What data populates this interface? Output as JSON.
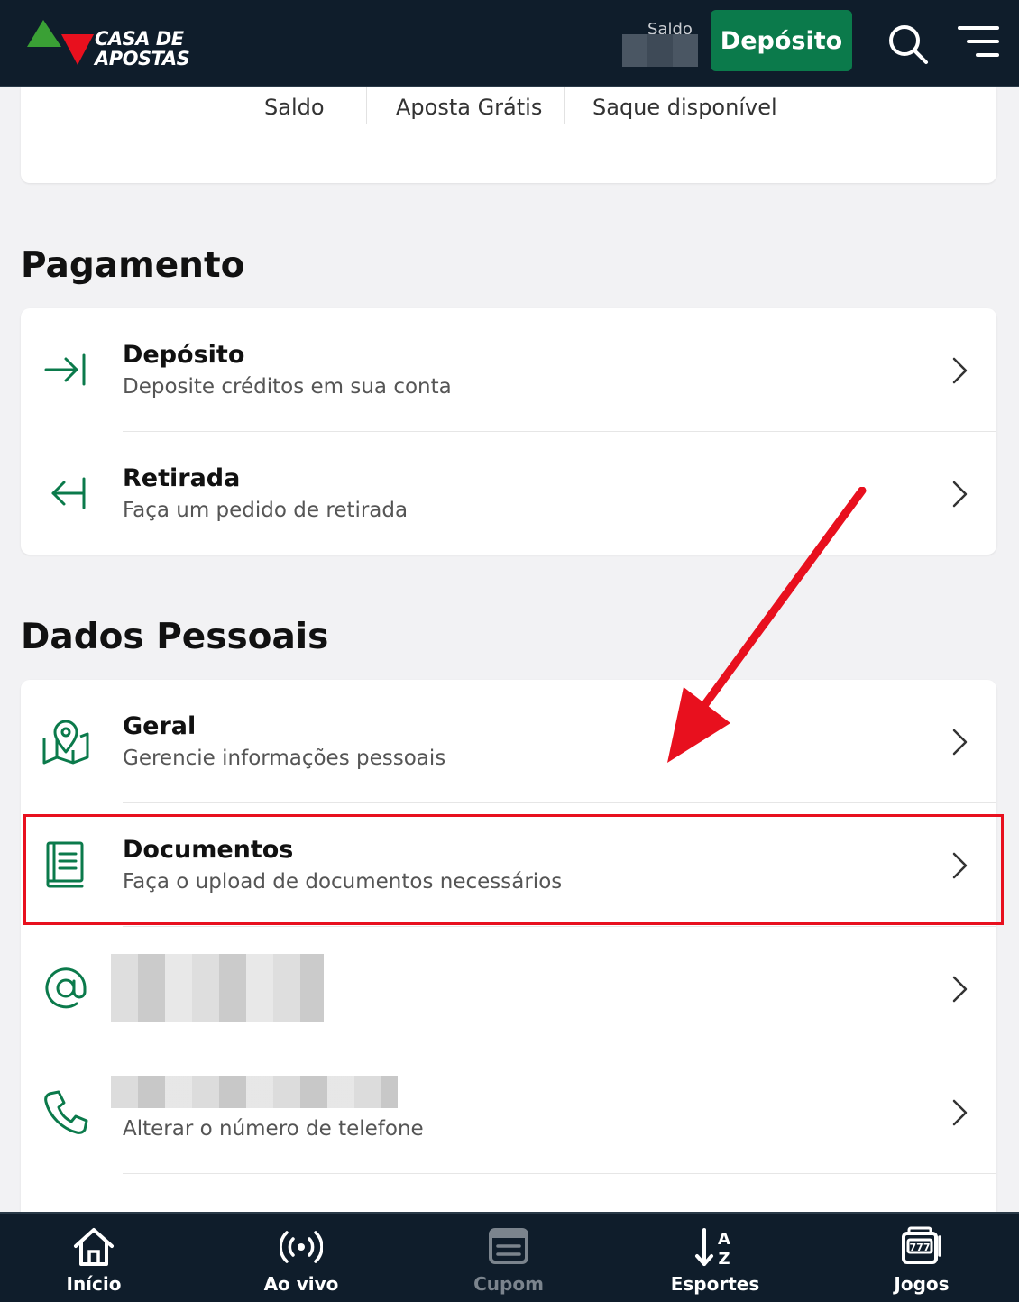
{
  "header": {
    "logo_line1": "CASA DE",
    "logo_line2": "APOSTAS",
    "saldo_label": "Saldo",
    "deposit_button": "Depósito"
  },
  "summary": {
    "items": [
      "Saldo",
      "Aposta Grátis",
      "Saque disponível"
    ]
  },
  "payment": {
    "title": "Pagamento",
    "items": [
      {
        "title": "Depósito",
        "subtitle": "Deposite créditos em sua conta"
      },
      {
        "title": "Retirada",
        "subtitle": "Faça um pedido de retirada"
      }
    ]
  },
  "personal": {
    "title": "Dados Pessoais",
    "items": [
      {
        "title": "Geral",
        "subtitle": "Gerencie informações pessoais"
      },
      {
        "title": "Documentos",
        "subtitle": "Faça o upload de documentos necessários"
      },
      {
        "title": "",
        "subtitle": ""
      },
      {
        "title": "",
        "subtitle": "Alterar o número de telefone"
      }
    ]
  },
  "bottom_nav": {
    "items": [
      {
        "label": "Início",
        "icon": "home-icon"
      },
      {
        "label": "Ao vivo",
        "icon": "live-icon"
      },
      {
        "label": "Cupom",
        "icon": "coupon-icon"
      },
      {
        "label": "Esportes",
        "icon": "sort-az-icon"
      },
      {
        "label": "Jogos",
        "icon": "slot-machine-icon"
      }
    ]
  },
  "colors": {
    "header_bg": "#0f1d2b",
    "accent_green": "#0b7a4b",
    "highlight_red": "#e8101e"
  }
}
